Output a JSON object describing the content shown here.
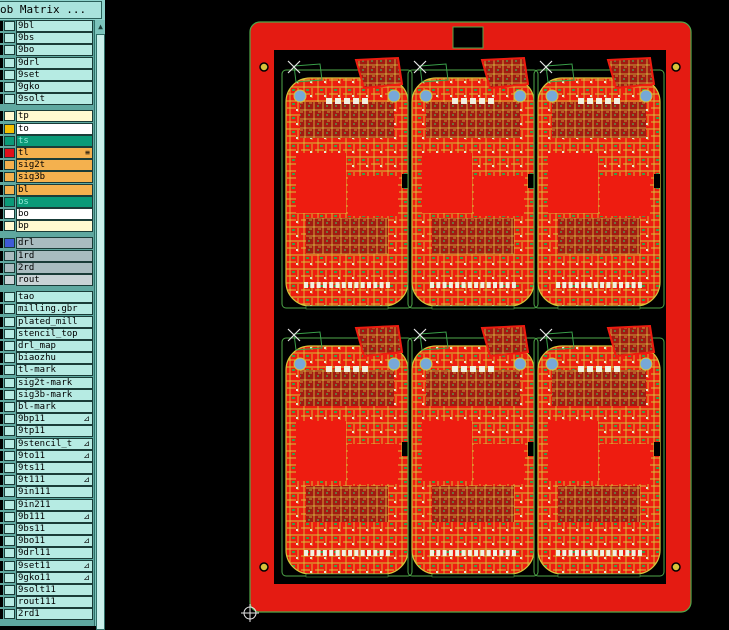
{
  "window": {
    "title": "ob Matrix ...",
    "menu_glyph": "▭"
  },
  "layers": [
    {
      "name": "9bl",
      "fill": "#b6ebe3",
      "swatch": "#b6ebe3",
      "mark": ""
    },
    {
      "name": "9bs",
      "fill": "#b6ebe3",
      "swatch": "#b6ebe3",
      "mark": ""
    },
    {
      "name": "9bo",
      "fill": "#b6ebe3",
      "swatch": "#b6ebe3",
      "mark": ""
    },
    {
      "name": "9drl",
      "fill": "#b6ebe3",
      "swatch": "#b6ebe3",
      "mark": ""
    },
    {
      "name": "9set",
      "fill": "#b6ebe3",
      "swatch": "#b6ebe3",
      "mark": ""
    },
    {
      "name": "9gko",
      "fill": "#b6ebe3",
      "swatch": "#b6ebe3",
      "mark": ""
    },
    {
      "name": "9solt",
      "fill": "#b6ebe3",
      "swatch": "#b6ebe3",
      "mark": ""
    },
    {
      "name": "tp",
      "fill": "#fffad0",
      "swatch": "#fffad0",
      "mark": ""
    },
    {
      "name": "to",
      "fill": "#ffffff",
      "swatch": "#f5c000",
      "mark": ""
    },
    {
      "name": "ts",
      "fill": "#0a9a78",
      "swatch": "#0a9a78",
      "mark": ""
    },
    {
      "name": "tl",
      "fill": "#f4b14e",
      "swatch": "#e0101a",
      "mark": "≡"
    },
    {
      "name": "sig2t",
      "fill": "#f4b14e",
      "swatch": "#f4b14e",
      "mark": ""
    },
    {
      "name": "sig3b",
      "fill": "#f4b14e",
      "swatch": "#f4b14e",
      "mark": ""
    },
    {
      "name": "bl",
      "fill": "#f4b14e",
      "swatch": "#f4b14e",
      "mark": ""
    },
    {
      "name": "bs",
      "fill": "#0a9a78",
      "swatch": "#0a9a78",
      "mark": ""
    },
    {
      "name": "bo",
      "fill": "#ffffff",
      "swatch": "#ffffff",
      "mark": ""
    },
    {
      "name": "bp",
      "fill": "#fffad0",
      "swatch": "#fffad0",
      "mark": ""
    },
    {
      "name": "drl",
      "fill": "#a9bcc0",
      "swatch": "#3f5bd6",
      "mark": ""
    },
    {
      "name": "1rd",
      "fill": "#a9bcc0",
      "swatch": "#a9bcc0",
      "mark": ""
    },
    {
      "name": "2rd",
      "fill": "#a9bcc0",
      "swatch": "#a9bcc0",
      "mark": ""
    },
    {
      "name": "rout",
      "fill": "#c9d3d6",
      "swatch": "#c9d3d6",
      "mark": ""
    },
    {
      "name": "tao",
      "fill": "#b6ebe3",
      "swatch": "#b6ebe3",
      "mark": ""
    },
    {
      "name": "milling.gbr",
      "fill": "#b6ebe3",
      "swatch": "#b6ebe3",
      "mark": ""
    },
    {
      "name": "plated_mill",
      "fill": "#b6ebe3",
      "swatch": "#b6ebe3",
      "mark": ""
    },
    {
      "name": "stencil_top",
      "fill": "#b6ebe3",
      "swatch": "#b6ebe3",
      "mark": ""
    },
    {
      "name": "drl_map",
      "fill": "#b6ebe3",
      "swatch": "#b6ebe3",
      "mark": ""
    },
    {
      "name": "biaozhu",
      "fill": "#b6ebe3",
      "swatch": "#b6ebe3",
      "mark": ""
    },
    {
      "name": "tl-mark",
      "fill": "#b6ebe3",
      "swatch": "#b6ebe3",
      "mark": ""
    },
    {
      "name": "sig2t-mark",
      "fill": "#b6ebe3",
      "swatch": "#b6ebe3",
      "mark": ""
    },
    {
      "name": "sig3b-mark",
      "fill": "#b6ebe3",
      "swatch": "#b6ebe3",
      "mark": ""
    },
    {
      "name": "bl-mark",
      "fill": "#b6ebe3",
      "swatch": "#b6ebe3",
      "mark": ""
    },
    {
      "name": "9bp11",
      "fill": "#b6ebe3",
      "swatch": "#b6ebe3",
      "mark": "⊿"
    },
    {
      "name": "9tp11",
      "fill": "#b6ebe3",
      "swatch": "#b6ebe3",
      "mark": ""
    },
    {
      "name": "9stencil_t",
      "fill": "#b6ebe3",
      "swatch": "#b6ebe3",
      "mark": "⊿"
    },
    {
      "name": "9to11",
      "fill": "#b6ebe3",
      "swatch": "#b6ebe3",
      "mark": "⊿"
    },
    {
      "name": "9ts11",
      "fill": "#b6ebe3",
      "swatch": "#b6ebe3",
      "mark": ""
    },
    {
      "name": "9t111",
      "fill": "#b6ebe3",
      "swatch": "#b6ebe3",
      "mark": "⊿"
    },
    {
      "name": "9in111",
      "fill": "#b6ebe3",
      "swatch": "#b6ebe3",
      "mark": ""
    },
    {
      "name": "9in211",
      "fill": "#b6ebe3",
      "swatch": "#b6ebe3",
      "mark": ""
    },
    {
      "name": "9b111",
      "fill": "#b6ebe3",
      "swatch": "#b6ebe3",
      "mark": "⊿"
    },
    {
      "name": "9bs11",
      "fill": "#b6ebe3",
      "swatch": "#b6ebe3",
      "mark": ""
    },
    {
      "name": "9bo11",
      "fill": "#b6ebe3",
      "swatch": "#b6ebe3",
      "mark": "⊿"
    },
    {
      "name": "9drl11",
      "fill": "#b6ebe3",
      "swatch": "#b6ebe3",
      "mark": ""
    },
    {
      "name": "9set11",
      "fill": "#b6ebe3",
      "swatch": "#b6ebe3",
      "mark": "⊿"
    },
    {
      "name": "9gko11",
      "fill": "#b6ebe3",
      "swatch": "#b6ebe3",
      "mark": "⊿"
    },
    {
      "name": "9solt11",
      "fill": "#b6ebe3",
      "swatch": "#b6ebe3",
      "mark": ""
    },
    {
      "name": "rout111",
      "fill": "#b6ebe3",
      "swatch": "#b6ebe3",
      "mark": ""
    },
    {
      "name": "2rd1",
      "fill": "#b6ebe3",
      "swatch": "#b6ebe3",
      "mark": ""
    }
  ],
  "scrollbar": {
    "up_arrow": "▲"
  },
  "board": {
    "panel_color": "#e41b12",
    "trace_color": "#d6c43a",
    "copper_color": "#ee1c10",
    "outline_color": "#4fa84a",
    "layout": {
      "columns": 3,
      "rows": 2
    }
  }
}
